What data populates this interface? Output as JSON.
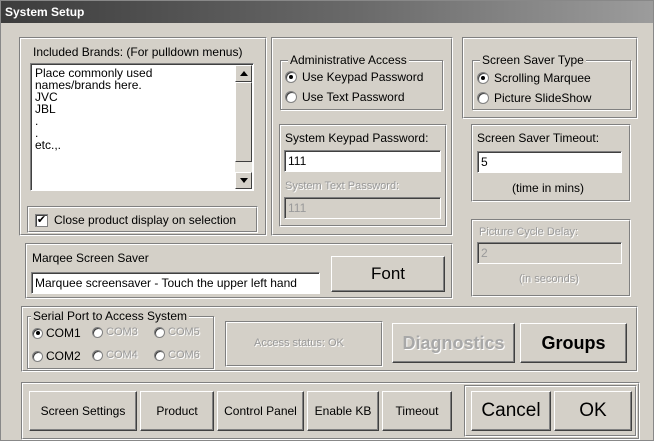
{
  "window": {
    "title": "System Setup"
  },
  "brands": {
    "label": "Included Brands: (For pulldown menus)",
    "items": [
      "Place commonly used",
      "names/brands here.",
      "JVC",
      "JBL",
      ".",
      ".",
      "etc.,."
    ],
    "scroll_up_icon": "triangle-up",
    "scroll_down_icon": "triangle-down"
  },
  "close_product": {
    "label": "Close product display on selection",
    "checked": true,
    "check_glyph": "✔"
  },
  "admin": {
    "legend": "Administrative Access",
    "options": [
      {
        "label": "Use Keypad Password",
        "selected": true
      },
      {
        "label": "Use Text Password",
        "selected": false
      }
    ],
    "keypad_label": "System Keypad Password:",
    "keypad_value": "111",
    "text_label": "System Text Password:",
    "text_value": "111"
  },
  "screensaver": {
    "legend": "Screen Saver Type",
    "options": [
      {
        "label": "Scrolling Marquee",
        "selected": true
      },
      {
        "label": "Picture SlideShow",
        "selected": false
      }
    ],
    "timeout_label": "Screen Saver Timeout:",
    "timeout_value": "5",
    "timeout_unit": "(time in mins)",
    "cycle_label": "Picture Cycle Delay:",
    "cycle_value": "2",
    "cycle_unit": "(in seconds)"
  },
  "marquee": {
    "label": "Marqee Screen Saver",
    "value": "Marquee screensaver - Touch the upper left hand",
    "font_button": "Font"
  },
  "serial": {
    "legend": "Serial Port to Access System",
    "ports": [
      {
        "label": "COM1",
        "selected": true,
        "enabled": true
      },
      {
        "label": "COM3",
        "selected": false,
        "enabled": false
      },
      {
        "label": "COM5",
        "selected": false,
        "enabled": false
      },
      {
        "label": "COM2",
        "selected": false,
        "enabled": true
      },
      {
        "label": "COM4",
        "selected": false,
        "enabled": false
      },
      {
        "label": "COM6",
        "selected": false,
        "enabled": false
      }
    ],
    "access_status": "Access status: OK"
  },
  "buttons": {
    "diagnostics": "Diagnostics",
    "groups": "Groups",
    "screen_settings": "Screen Settings",
    "product": "Product",
    "control_panel": "Control Panel",
    "enable_kb": "Enable KB",
    "timeout": "Timeout",
    "cancel": "Cancel",
    "ok": "OK"
  },
  "colors": {
    "face": "#d4d0c8",
    "title_dark": "#3c3c3c",
    "disabled_text": "#9a9a9a"
  }
}
